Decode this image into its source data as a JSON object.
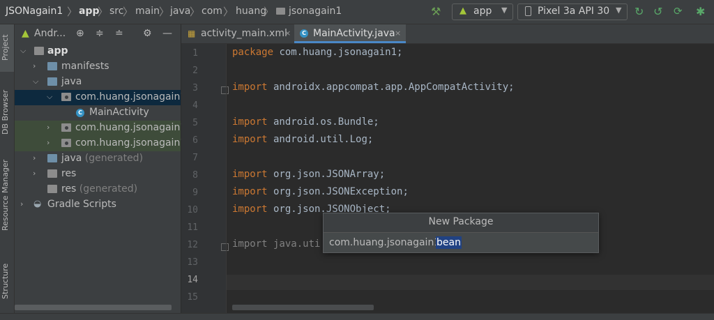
{
  "breadcrumb": [
    "JSONagain1",
    "app",
    "src",
    "main",
    "java",
    "com",
    "huang",
    "jsonagain1"
  ],
  "run_config": "app",
  "device": "Pixel 3a API 30",
  "left_tool_tabs": [
    "Project",
    "DB Browser",
    "Resource Manager",
    "Structure"
  ],
  "project_view_label": "Andr...",
  "tree": [
    {
      "label": "app",
      "arrow": "v"
    },
    {
      "label": "manifests",
      "arrow": ">"
    },
    {
      "label": "java",
      "arrow": "v"
    },
    {
      "label": "com.huang.jsonagain1",
      "arrow": "v"
    },
    {
      "label": "MainActivity",
      "arrow": ""
    },
    {
      "label": "com.huang.jsonagain1",
      "arrow": ">"
    },
    {
      "label": "com.huang.jsonagain1",
      "arrow": ">"
    },
    {
      "label": "java",
      "arrow": ">",
      "suffix": " (generated)"
    },
    {
      "label": "res",
      "arrow": ">"
    },
    {
      "label": "res",
      "arrow": "",
      "suffix": " (generated)"
    },
    {
      "label": "Gradle Scripts",
      "arrow": ">"
    }
  ],
  "tabs": [
    {
      "label": "activity_main.xml",
      "close": "×"
    },
    {
      "label": "MainActivity.java",
      "close": "×"
    }
  ],
  "line_numbers": [
    "1",
    "2",
    "3",
    "4",
    "5",
    "6",
    "7",
    "8",
    "9",
    "10",
    "11",
    "12",
    "13",
    "14",
    "15"
  ],
  "code": {
    "l1_kw": "package",
    "l1_rest": " com.huang.jsonagain1;",
    "l3_kw": "import",
    "l3_rest": " androidx.appcompat.app.AppCompatActivity;",
    "l5_kw": "import",
    "l5_rest": " android.os.Bundle;",
    "l6_kw": "import",
    "l6_rest": " android.util.Log;",
    "l8_kw": "import",
    "l8_rest": " org.json.JSONArray;",
    "l9_kw": "import",
    "l9_rest": " org.json.JSONException;",
    "l10_kw": "import",
    "l10_rest": " org.json.JSONObject;",
    "l12": "import java.uti"
  },
  "new_package_dialog": {
    "title": "New Package",
    "value_prefix": "com.huang.jsonagain1.",
    "value_selected": "bean"
  }
}
